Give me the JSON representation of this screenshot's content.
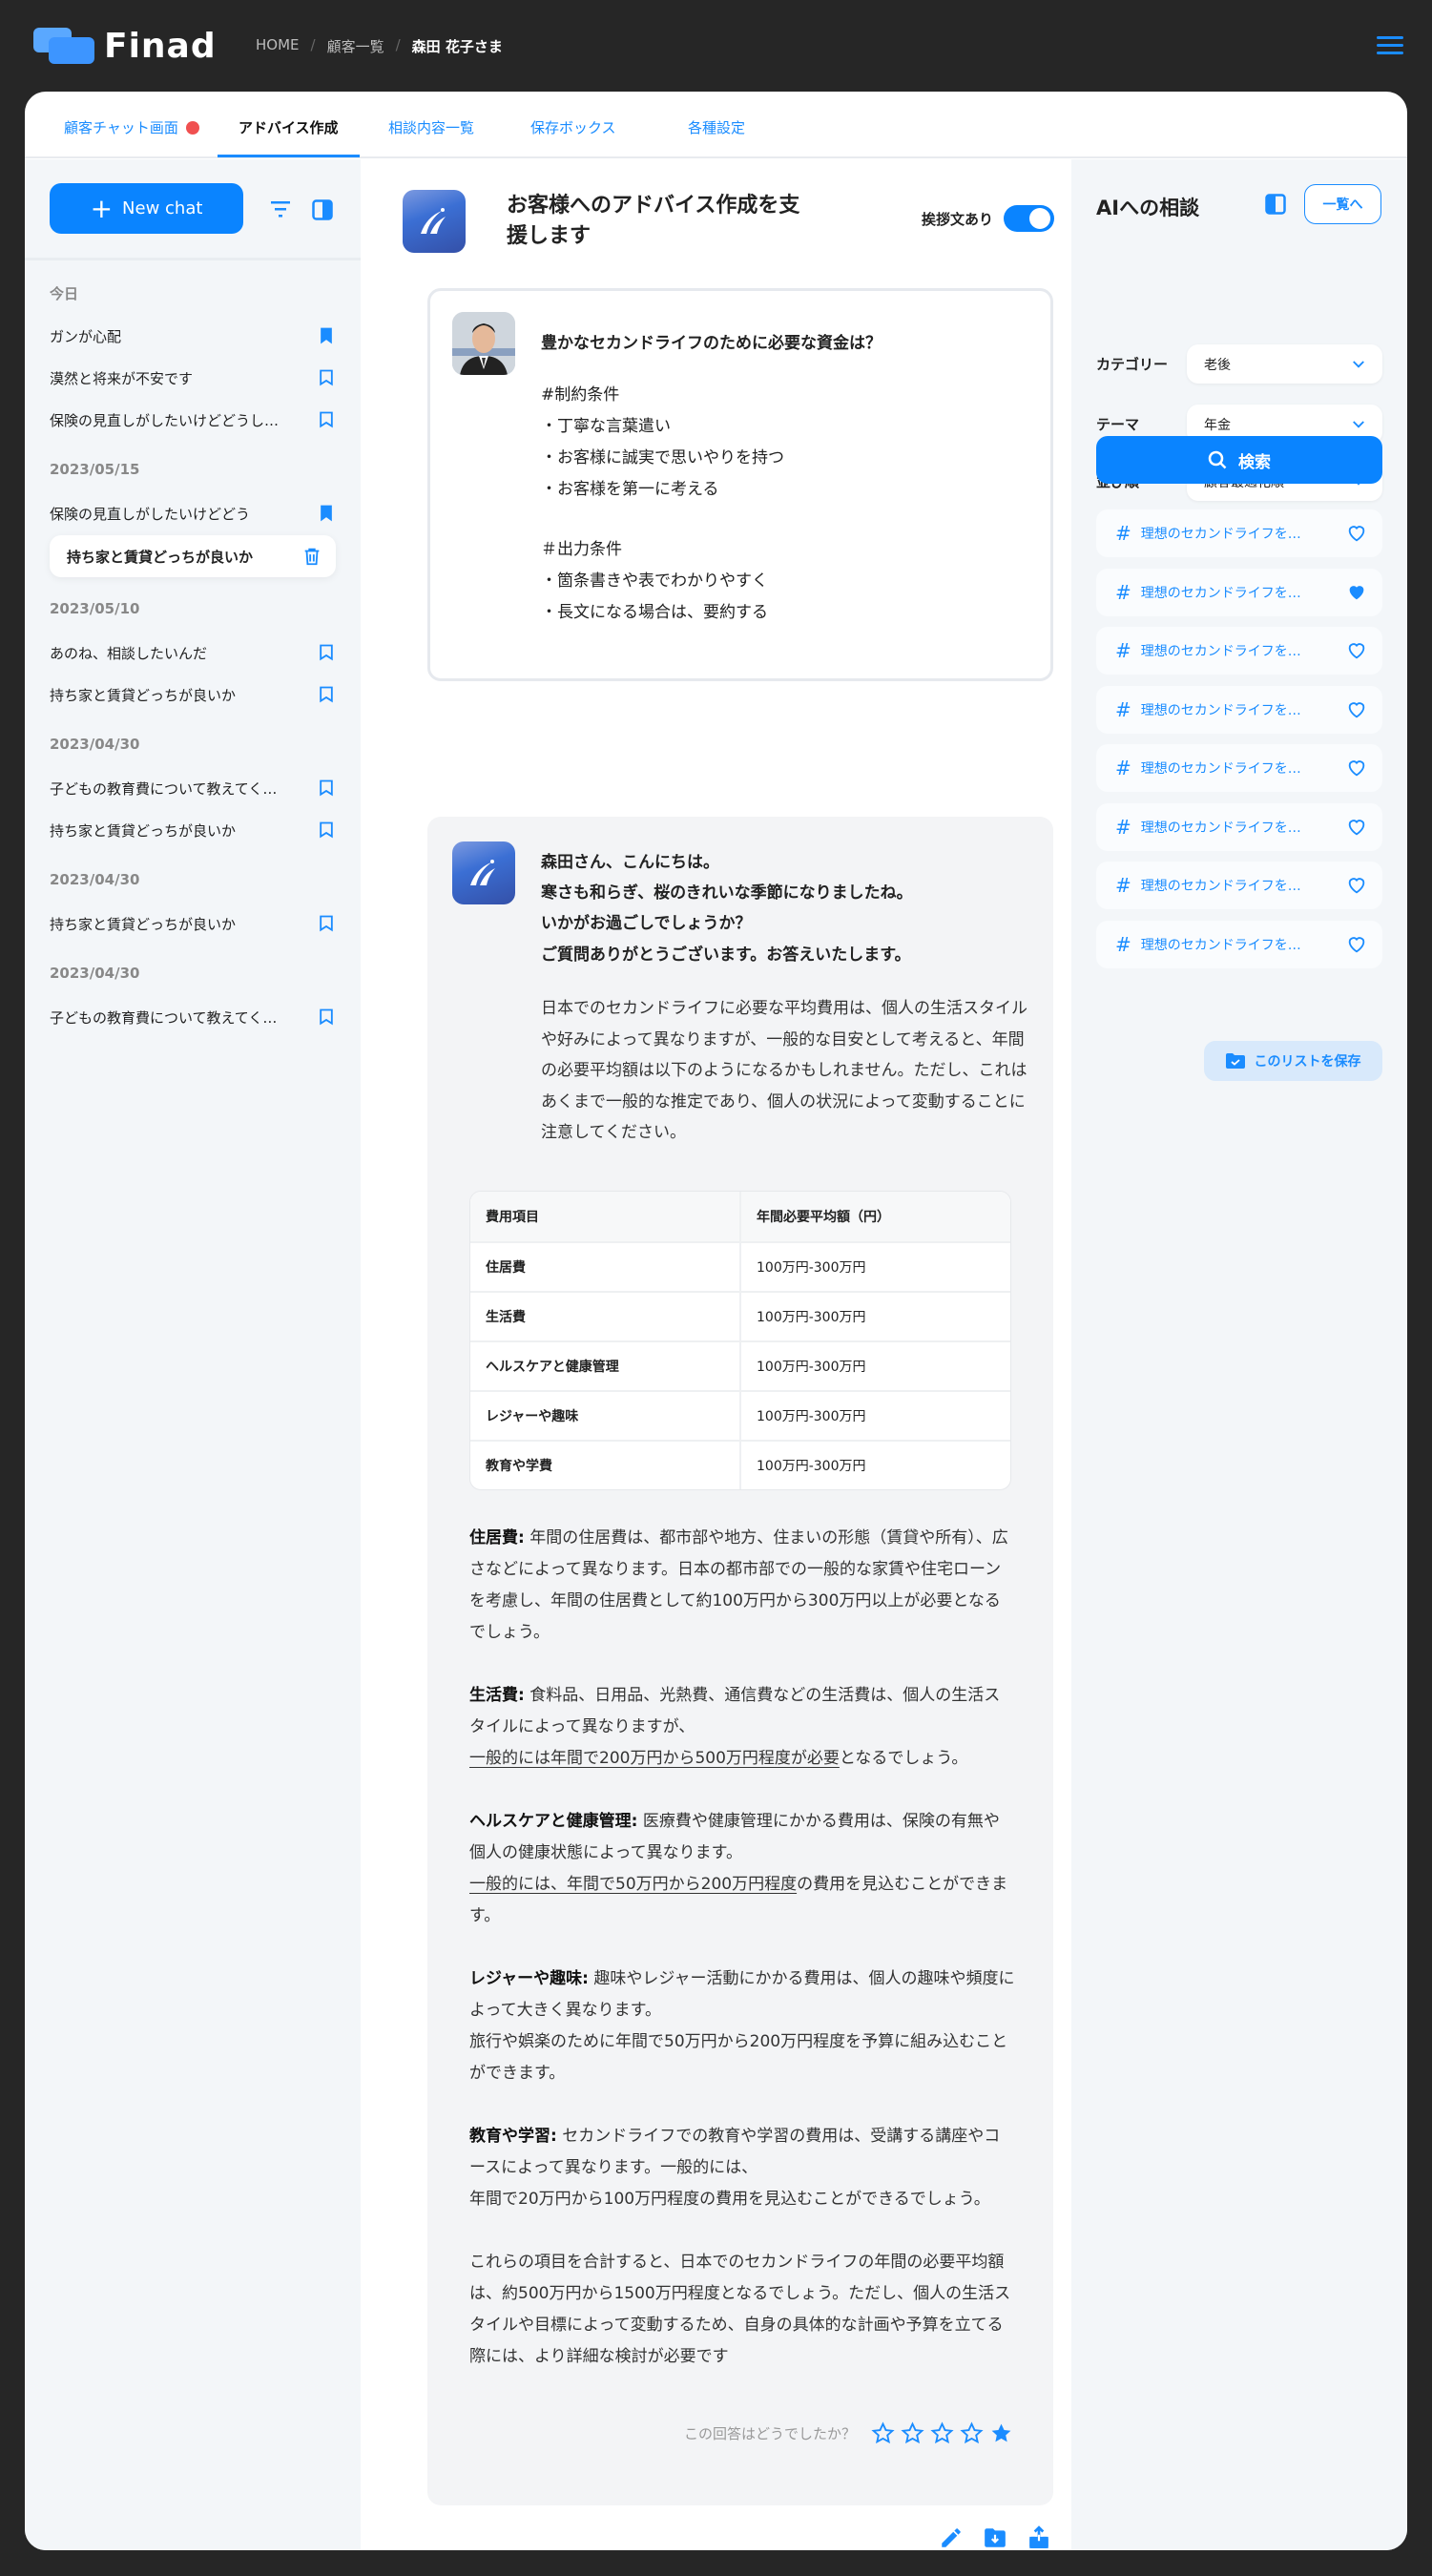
{
  "header": {
    "logo": "Finad",
    "breadcrumb": [
      "HOME",
      "顧客一覧",
      "森田 花子さま"
    ]
  },
  "tabs": [
    {
      "label": "顧客チャット画面",
      "notification": true
    },
    {
      "label": "アドバイス作成",
      "active": true
    },
    {
      "label": "相談内容一覧"
    },
    {
      "label": "保存ボックス"
    },
    {
      "label": "各種設定"
    }
  ],
  "sidebar": {
    "new_chat": "New chat",
    "groups": [
      {
        "date": "今日",
        "items": [
          {
            "label": "ガンが心配",
            "bookmarked": true
          },
          {
            "label": "漠然と将来が不安です",
            "bookmarked": false
          },
          {
            "label": "保険の見直しがしたいけどどうし…",
            "bookmarked": false
          }
        ]
      },
      {
        "date": "2023/05/15",
        "items": [
          {
            "label": "保険の見直しがしたいけどどう",
            "bookmarked": true
          },
          {
            "label": "持ち家と賃貸どっちが良いか",
            "selected": true
          }
        ]
      },
      {
        "date": "2023/05/10",
        "items": [
          {
            "label": "あのね、相談したいんだ",
            "bookmarked": false
          },
          {
            "label": "持ち家と賃貸どっちが良いか",
            "bookmarked": false
          }
        ]
      },
      {
        "date": "2023/04/30",
        "items": [
          {
            "label": "子どもの教育費について教えてく…",
            "bookmarked": false
          },
          {
            "label": "持ち家と賃貸どっちが良いか",
            "bookmarked": false
          }
        ]
      },
      {
        "date": "2023/04/30",
        "items": [
          {
            "label": "持ち家と賃貸どっちが良いか",
            "bookmarked": false
          }
        ]
      },
      {
        "date": "2023/04/30",
        "items": [
          {
            "label": "子どもの教育費について教えてく…",
            "bookmarked": false
          }
        ]
      }
    ]
  },
  "main": {
    "title": "お客様へのアドバイス作成を支援します",
    "greeting_toggle_label": "挨拶文あり",
    "greeting_toggle_on": true,
    "prompt": {
      "question": "豊かなセカンドライフのために必要な資金は？",
      "lines": [
        "#制約条件",
        "・丁寧な言葉遣い",
        "・お客様に誠実で思いやりを持つ",
        "・お客様を第一に考える",
        "＃出力条件",
        "・箇条書きや表でわかりやすく",
        "・長文になる場合は、要約する"
      ]
    },
    "answer": {
      "greeting": [
        "森田さん、こんにちは。",
        "寒さも和らぎ、桜のきれいな季節になりましたね。",
        "いかがお過ごしでしょうか？",
        "ご質問ありがとうございます。お答えいたします。"
      ],
      "intro": "日本でのセカンドライフに必要な平均費用は、個人の生活スタイルや好みによって異なりますが、一般的な目安として考えると、年間の必要平均額は以下のようになるかもしれません。ただし、これはあくまで一般的な推定であり、個人の状況によって変動することに注意してください。",
      "table": {
        "headers": [
          "費用項目",
          "年間必要平均額（円）"
        ],
        "rows": [
          [
            "住居費",
            "100万円-300万円"
          ],
          [
            "生活費",
            "100万円-300万円"
          ],
          [
            "ヘルスケアと健康管理",
            "100万円-300万円"
          ],
          [
            "レジャーや趣味",
            "100万円-300万円"
          ],
          [
            "教育や学費",
            "100万円-300万円"
          ]
        ]
      },
      "paragraphs": [
        [
          {
            "b": "住居費:"
          },
          {
            "t": " 年間の住居費は、都市部や地方、住まいの形態（賃貸や所有）、広さなどによって異なります。日本の都市部での一般的な家賃や住宅ローンを考慮し、年間の住居費として約100万円から300万円以上が必要となるでしょう。"
          }
        ],
        [
          {
            "b": "生活費:"
          },
          {
            "t": " 食料品、日用品、光熱費、通信費などの生活費は、個人の生活スタイルによって異なりますが、"
          },
          {
            "br": true
          },
          {
            "u": "一般的には年間で200万円から500万円程度が必要"
          },
          {
            "t": "となるでしょう。"
          }
        ],
        [
          {
            "b": "ヘルスケアと健康管理:"
          },
          {
            "t": " 医療費や健康管理にかかる費用は、保険の有無や個人の健康状態によって異なります。"
          },
          {
            "br": true
          },
          {
            "u": "一般的には、年間で50万円から200万円程度"
          },
          {
            "t": "の費用を見込むことができます。"
          }
        ],
        [
          {
            "b": "レジャーや趣味:"
          },
          {
            "t": " 趣味やレジャー活動にかかる費用は、個人の趣味や頻度によって大きく異なります。"
          },
          {
            "br": true
          },
          {
            "t": "旅行や娯楽のために年間で50万円から200万円程度を予算に組み込むことができます。"
          }
        ],
        [
          {
            "b": "教育や学習:"
          },
          {
            "t": " セカンドライフでの教育や学習の費用は、受講する講座やコースによって異なります。一般的には、"
          },
          {
            "br": true
          },
          {
            "t": "年間で20万円から100万円程度の費用を見込むことができるでしょう。"
          }
        ],
        [
          {
            "t": "これらの項目を合計すると、日本でのセカンドライフの年間の必要平均額は、約500万円から1500万円程度となるでしょう。ただし、個人の生活スタイルや目標によって変動するため、自身の具体的な計画や予算を立てる際には、より詳細な検討が必要です"
          }
        ]
      ],
      "rating_label": "この回答はどうでしたか？",
      "rating": 1,
      "rating_max": 5
    }
  },
  "ai_panel": {
    "title": "AIへの相談",
    "list_button": "一覧へ",
    "filters": [
      {
        "label": "カテゴリー",
        "value": "老後"
      },
      {
        "label": "テーマ",
        "value": "年金"
      },
      {
        "label": "並び順",
        "value": "顧客最適化順"
      }
    ],
    "search_button": "検索",
    "results": [
      {
        "label": "理想のセカンドライフを…",
        "liked": false
      },
      {
        "label": "理想のセカンドライフを…",
        "liked": true
      },
      {
        "label": "理想のセカンドライフを…",
        "liked": false
      },
      {
        "label": "理想のセカンドライフを…",
        "liked": false
      },
      {
        "label": "理想のセカンドライフを…",
        "liked": false
      },
      {
        "label": "理想のセカンドライフを…",
        "liked": false
      },
      {
        "label": "理想のセカンドライフを…",
        "liked": false
      },
      {
        "label": "理想のセカンドライフを…",
        "liked": false
      }
    ],
    "save_list_button": "このリストを保存"
  },
  "colors": {
    "accent": "#0a84ff",
    "background": "#262626",
    "panel": "#f3f6f9",
    "notification": "#f05050"
  }
}
